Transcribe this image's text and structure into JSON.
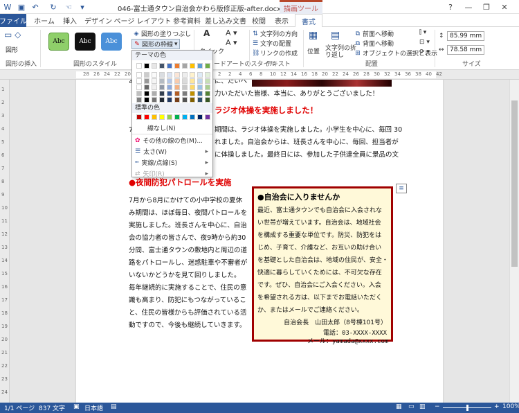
{
  "title_bar": {
    "document_title": "046-富士通タウン自治会かわら版修正版-after.docx - Word",
    "context_tool": "描画ツール",
    "qat_save_icon": "save-icon",
    "qat_undo_icon": "undo-icon",
    "qat_redo_icon": "redo-icon",
    "help": "?",
    "minimize": "—",
    "restore": "❐",
    "close": "✕"
  },
  "tabs": [
    {
      "label": "ファイル"
    },
    {
      "label": "ホーム"
    },
    {
      "label": "挿入"
    },
    {
      "label": "デザイン"
    },
    {
      "label": "ページ レイアウト"
    },
    {
      "label": "参考資料"
    },
    {
      "label": "差し込み文書"
    },
    {
      "label": "校閲"
    },
    {
      "label": "表示"
    },
    {
      "label": "書式"
    }
  ],
  "ribbon": {
    "insert_shapes_group": "図形の挿入",
    "shape_label": "図形",
    "style_group": "図形のスタイル",
    "style_swatch_text": "Abc",
    "fill_label": "図形の塗りつぶし",
    "outline_label": "図形の枠線",
    "wordart_group": "ワードアートのスタイル",
    "quick_style_label": "クイック",
    "text_group": "テキスト",
    "text_direction": "文字列の方向",
    "text_align": "文字の配置",
    "create_link": "リンクの作成",
    "position_label": "位置",
    "wrap_label": "文字列の折り返し",
    "arrange_group": "配置",
    "bring_forward": "前面へ移動",
    "send_backward": "背面へ移動",
    "selection_pane": "オブジェクトの選択と表示",
    "size_group": "サイズ",
    "height_value": "85.99 mm",
    "width_value": "78.58 mm"
  },
  "ruler_numbers": [
    "28",
    "26",
    "24",
    "22",
    "20",
    "18",
    "16",
    "14",
    "12",
    "10",
    "8",
    "6",
    "4",
    "2",
    "2",
    "4",
    "6",
    "8",
    "10",
    "12",
    "14",
    "16",
    "18",
    "20",
    "22",
    "24",
    "26",
    "28",
    "30",
    "32",
    "34",
    "36",
    "38",
    "40",
    "42"
  ],
  "vruler_numbers": [
    "1",
    "2",
    "3",
    "4",
    "5",
    "6",
    "7",
    "8",
    "9",
    "10",
    "11",
    "12",
    "13",
    "14",
    "15",
    "16",
    "17",
    "18",
    "19",
    "20",
    "21",
    "22",
    "23",
    "24"
  ],
  "dropdown": {
    "theme_colors_label": "テーマの色",
    "standard_colors_label": "標準の色",
    "no_outline": "線なし(N)",
    "more_colors": "その他の線の色(M)...",
    "weight": "太さ(W)",
    "dashes": "実線/点線(S)",
    "arrows": "矢印(R)",
    "theme_top": [
      "#ffffff",
      "#000000",
      "#e7e6e6",
      "#44546a",
      "#4472c4",
      "#ed7d31",
      "#a5a5a5",
      "#ffc000",
      "#5b9bd5",
      "#70ad47"
    ],
    "standard": [
      "#c00000",
      "#ff0000",
      "#ffc000",
      "#ffff00",
      "#92d050",
      "#00b050",
      "#00b0f0",
      "#0070c0",
      "#002060",
      "#7030a0"
    ]
  },
  "document": {
    "top_line1": "あ",
    "top_line1b": "に、たいへ",
    "top_line2": "力いただいた皆様、本当に、ありがとうございました！",
    "heading1": "ラジオ体操を実施しました！",
    "p1_l1a": "7",
    "p1_l1": "期間は、ラジオ体操を実施しました。小学生を中心に、毎回 30",
    "p1_l2": "れました。自治会からは、班長さんを中心に、毎回、担当者が",
    "p1_l3": "に体操しました。最終日には、参加した子供達全員に景品の文",
    "heading2": "●夜間防犯パトロールを実施",
    "p2": [
      "7月から8月にかけての小中学校の夏休",
      "み期間は、ほぼ毎日、夜間パトロールを",
      "実施しました。班長さんを中心に、自治",
      "会の協力者の皆さんで、夜9時から約30",
      "分間、富士通タウンの敷地内と周辺の道",
      "路をパトロールし、迷惑駐車や不審者が",
      "いないかどうかを見て回りしました。",
      "毎年継続的に実施することで、住民の意",
      "識も高まり、防犯にもつながっているこ",
      "と、住民の皆様からも評価されている活",
      "動ですので、今後も継続していきます。"
    ],
    "textbox_title": "●自治会に入りませんか",
    "textbox_lines": [
      "最近、富士通タウンでも自治会に入会されな",
      "い世帯が増えています。自治会は、地域社会",
      "を構成する重要な単位です。防災、防犯をは",
      "じめ、子育て、介護など、お互いの助け合い",
      "を基礎とした自治会は、地域の住民が、安全・",
      "快適に暮らしていくためには、不可欠な存在",
      "です。ぜひ、自治会にご入会ください。入会",
      "を希望される方は、以下までお電話いただく",
      "か、またはメールでご連絡ください。"
    ],
    "signature": "自治会長　山田太郎（8号棟101号）",
    "phone": "電話：03-XXXX-XXXX",
    "email": "メール：yamada@xxxx.com"
  },
  "status_bar": {
    "page": "1/1 ページ",
    "words": "837 文字",
    "language": "日本語",
    "zoom": "100%"
  }
}
